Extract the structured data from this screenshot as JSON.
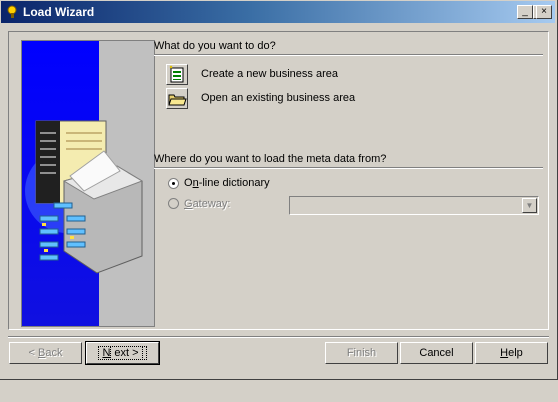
{
  "window": {
    "title": "Load Wizard",
    "controls": {
      "minimize": "_",
      "maximize": "□",
      "close": "×"
    }
  },
  "section1": {
    "heading": "What do you want to do?",
    "options": [
      {
        "label": "Create a new business area",
        "icon": "new-business-area-icon"
      },
      {
        "label": "Open an existing business area",
        "icon": "open-folder-icon"
      }
    ]
  },
  "section2": {
    "heading": "Where do you want to load the meta data from?",
    "online": {
      "prefix": "O",
      "accel": "n",
      "rest": "-line dictionary",
      "selected": true
    },
    "gateway": {
      "accel": "G",
      "rest": "ateway:",
      "selected": false,
      "enabled": false
    },
    "gateway_value": ""
  },
  "buttons": {
    "back": {
      "prefix": "< ",
      "accel": "B",
      "rest": "ack",
      "enabled": false
    },
    "next": {
      "accel": "N",
      "rest": "ext >",
      "enabled": true,
      "default": true
    },
    "finish": {
      "label": "Finish",
      "enabled": false
    },
    "cancel": {
      "label": "Cancel",
      "enabled": true
    },
    "help": {
      "accel": "H",
      "rest": "elp",
      "enabled": true
    }
  },
  "colors": {
    "title_start": "#0a246a",
    "title_end": "#a6caf0",
    "art_blue": "#0000ff",
    "face": "#d4d0c8"
  }
}
